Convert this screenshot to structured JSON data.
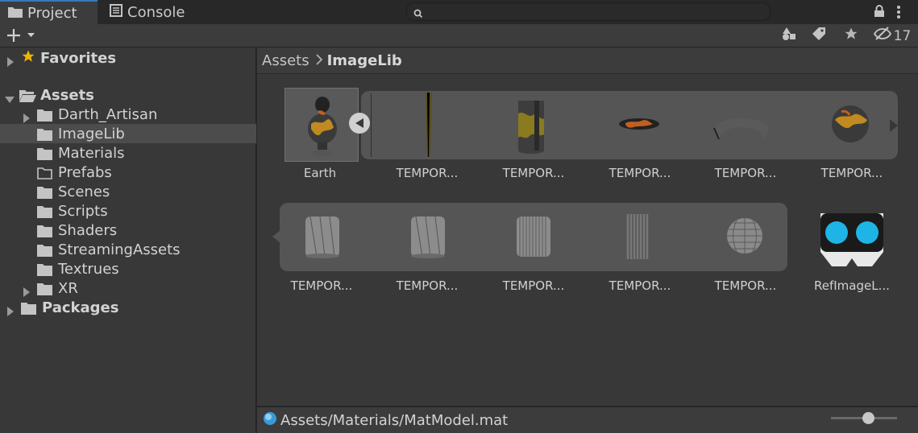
{
  "tabs": [
    {
      "label": "Project"
    },
    {
      "label": "Console"
    }
  ],
  "toolbar": {
    "hidden_count": "17",
    "search_placeholder": ""
  },
  "tree": {
    "favorites": "Favorites",
    "assets": "Assets",
    "children": [
      "Darth_Artisan",
      "ImageLib",
      "Materials",
      "Prefabs",
      "Scenes",
      "Scripts",
      "Shaders",
      "StreamingAssets",
      "Textrues",
      "XR"
    ],
    "packages": "Packages"
  },
  "breadcrumb": {
    "root": "Assets",
    "current": "ImageLib"
  },
  "grid": {
    "row1": [
      "Earth",
      "TEMPOR...",
      "TEMPOR...",
      "TEMPOR...",
      "TEMPOR...",
      "TEMPOR..."
    ],
    "row2": [
      "TEMPOR...",
      "TEMPOR...",
      "TEMPOR...",
      "TEMPOR...",
      "TEMPOR...",
      "RefImageL..."
    ]
  },
  "status": {
    "path": "Assets/Materials/MatModel.mat"
  },
  "colors": {
    "selected_tab_accent": "#3a79bb",
    "favorites_star": "#f0b400",
    "ref_image_lens": "#1eb4e6"
  }
}
